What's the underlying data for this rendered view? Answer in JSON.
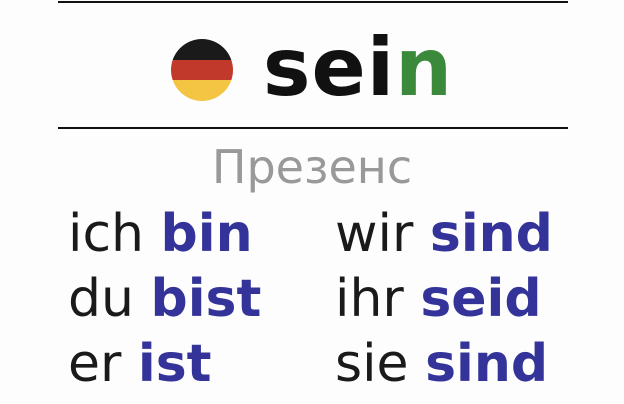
{
  "header": {
    "verb_stem": "sei",
    "verb_tail": "n",
    "flag_colors": [
      "#1a1a1a",
      "#c0392b",
      "#f4c542"
    ]
  },
  "tense": "Презенс",
  "colors": {
    "pronoun": "#1a1a1a",
    "form": "#333399",
    "tense": "#999999",
    "verb_tail": "#3b8a3b"
  },
  "conjugation": [
    {
      "pronoun": "ich",
      "form": "bin"
    },
    {
      "pronoun": "du",
      "form": "bist"
    },
    {
      "pronoun": "er",
      "form": "ist"
    },
    {
      "pronoun": "wir",
      "form": "sind"
    },
    {
      "pronoun": "ihr",
      "form": "seid"
    },
    {
      "pronoun": "sie",
      "form": "sind"
    }
  ]
}
